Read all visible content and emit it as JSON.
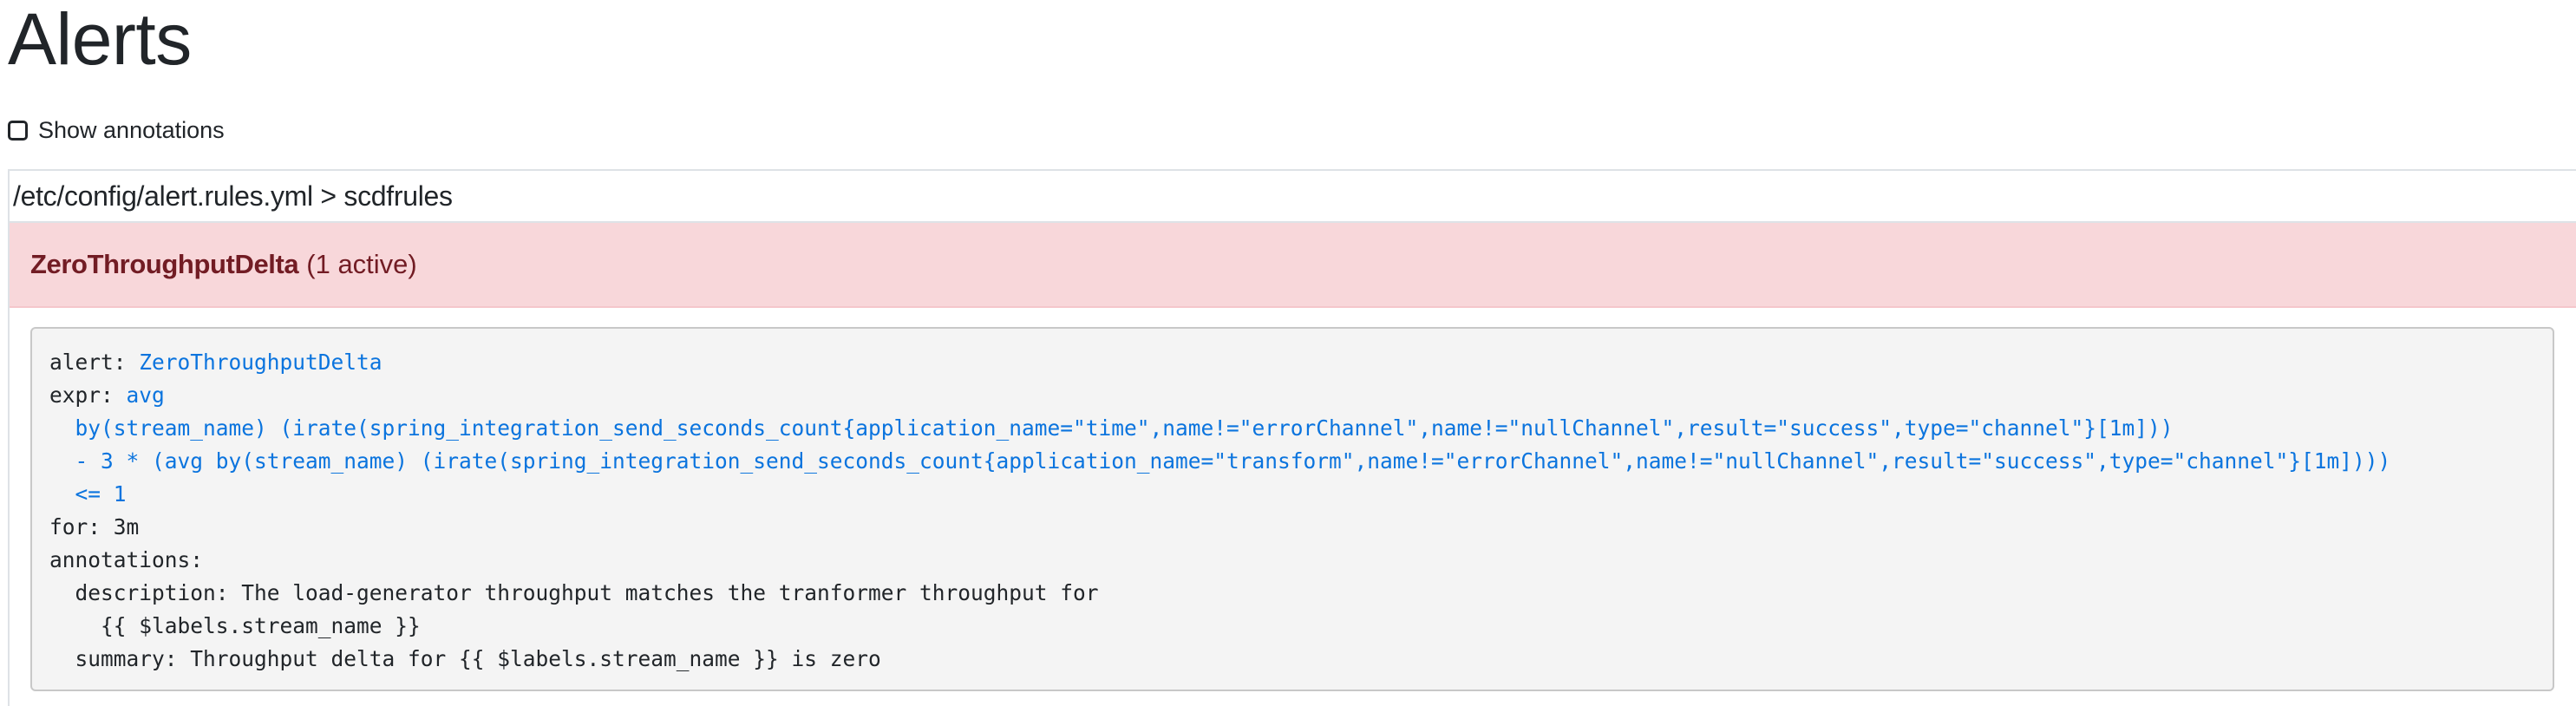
{
  "page": {
    "title": "Alerts"
  },
  "controls": {
    "show_annotations_label": "Show annotations",
    "show_annotations_checked": false
  },
  "rule_group": {
    "header": "/etc/config/alert.rules.yml > scdfrules",
    "alerts": [
      {
        "name": "ZeroThroughputDelta",
        "active_label": "(1 active)",
        "state_color": "#f8d7da",
        "definition": {
          "alert_key": "alert:",
          "alert_value": "ZeroThroughputDelta",
          "expr_key": "expr:",
          "expr_lines": [
            "avg",
            "  by(stream_name) (irate(spring_integration_send_seconds_count{application_name=\"time\",name!=\"errorChannel\",name!=\"nullChannel\",result=\"success\",type=\"channel\"}[1m]))",
            "  - 3 * (avg by(stream_name) (irate(spring_integration_send_seconds_count{application_name=\"transform\",name!=\"errorChannel\",name!=\"nullChannel\",result=\"success\",type=\"channel\"}[1m])))",
            "  <= 1"
          ],
          "for_line": "for: 3m",
          "annotations_key": "annotations:",
          "description_line_1": "  description: The load-generator throughput matches the tranformer throughput for",
          "description_line_2": "    {{ $labels.stream_name }}",
          "summary_line": "  summary: Throughput delta for {{ $labels.stream_name }} is zero"
        }
      }
    ]
  },
  "colors": {
    "alert_firing_bg": "#f8d7da",
    "alert_firing_text": "#721c24",
    "code_value_blue": "#0b74de",
    "code_bg": "#f4f4f4"
  }
}
